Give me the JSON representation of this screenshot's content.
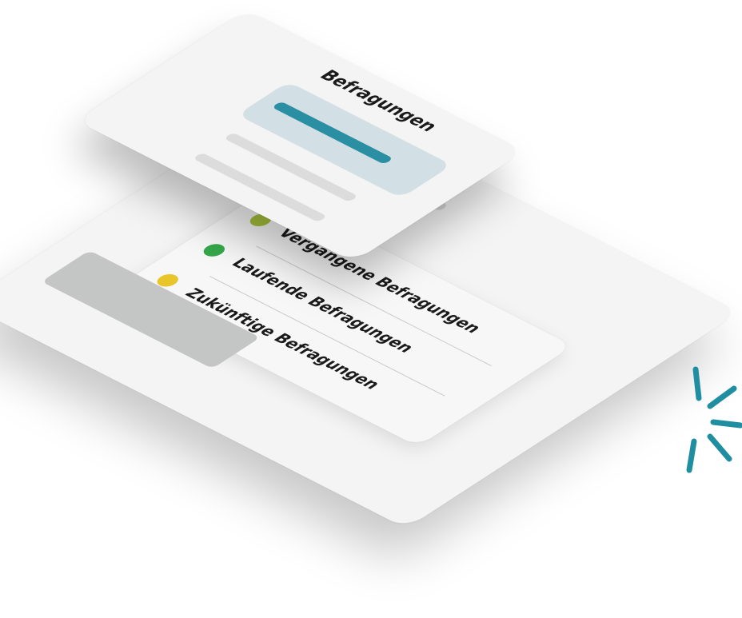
{
  "top_card": {
    "title": "Befragungen"
  },
  "survey_list": {
    "items": [
      {
        "label": "Vergangene Befragungen",
        "color": "#a6c23c"
      },
      {
        "label": "Laufende Befragungen",
        "color": "#34a74a"
      },
      {
        "label": "Zukünftige Befragungen",
        "color": "#e8c62a"
      }
    ]
  },
  "colors": {
    "accent": "#2b8fa3",
    "selected_background": "#d2dfe4",
    "card_background": "#f4f4f4",
    "placeholder_gray": "#c4c5c5"
  },
  "icons": {
    "sparkle": "sparkle-icon"
  }
}
